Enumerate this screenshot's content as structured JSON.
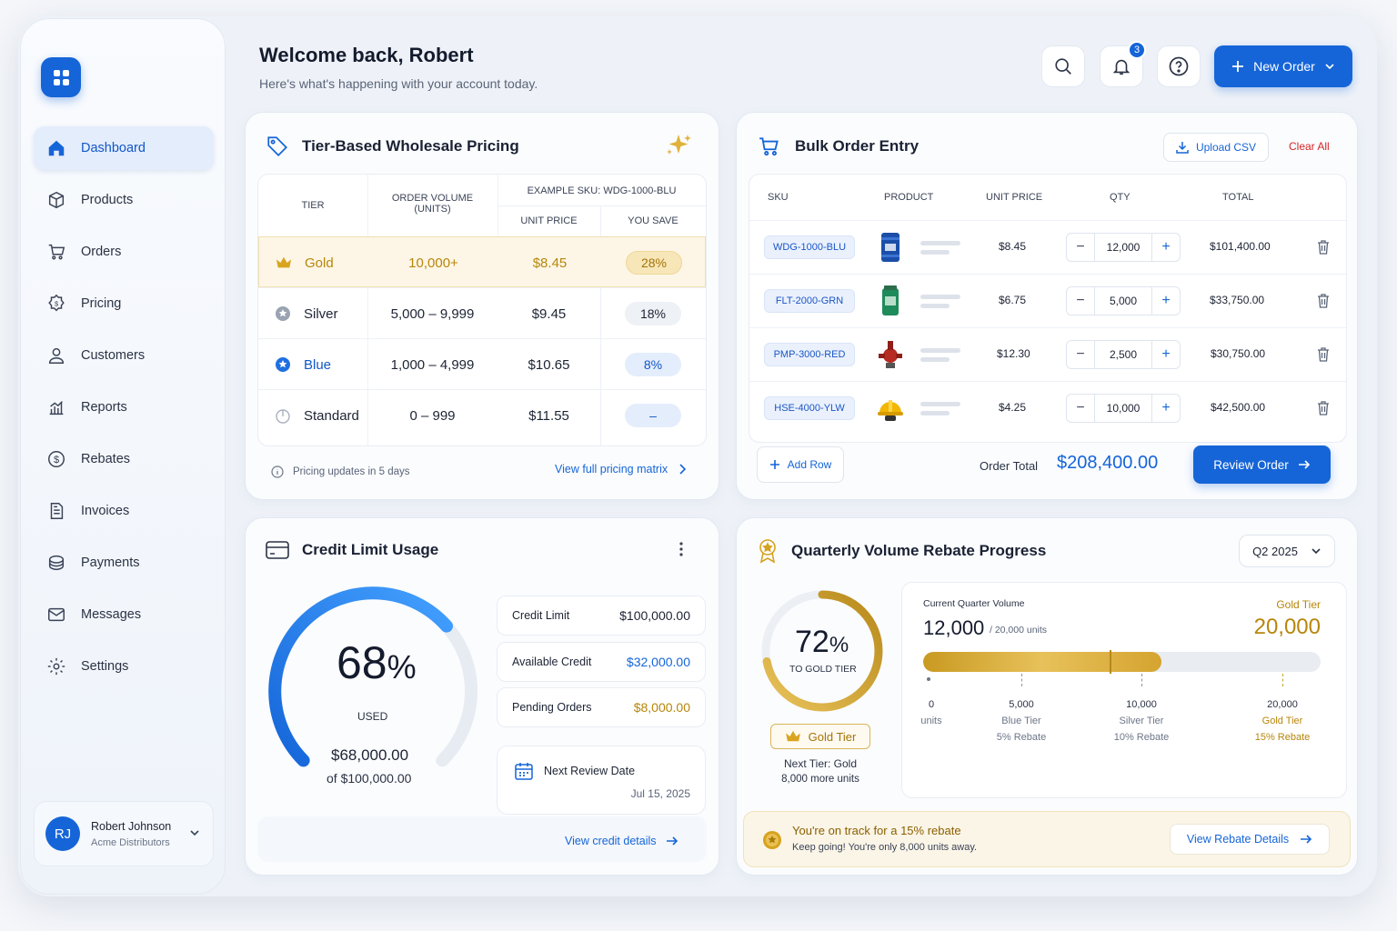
{
  "sidebar": {
    "items": [
      {
        "label": "Dashboard",
        "icon": "home-icon"
      },
      {
        "label": "Products",
        "icon": "box-icon"
      },
      {
        "label": "Orders",
        "icon": "cart-icon"
      },
      {
        "label": "Pricing",
        "icon": "price-badge-icon"
      },
      {
        "label": "Customers",
        "icon": "user-icon"
      },
      {
        "label": "Reports",
        "icon": "bar-chart-icon"
      },
      {
        "label": "Rebates",
        "icon": "dollar-coin-icon"
      },
      {
        "label": "Invoices",
        "icon": "document-icon"
      },
      {
        "label": "Payments",
        "icon": "payment-icon"
      },
      {
        "label": "Messages",
        "icon": "mail-icon"
      },
      {
        "label": "Settings",
        "icon": "gear-icon"
      }
    ],
    "user": {
      "initials": "RJ",
      "name": "Robert Johnson",
      "company": "Acme Distributors"
    }
  },
  "header": {
    "title": "Welcome back, Robert",
    "subtitle": "Here's what's happening with your account today.",
    "notifications": "3",
    "new_order": "New Order"
  },
  "pricing": {
    "title": "Tier-Based Wholesale Pricing",
    "headers": {
      "tier": "TIER",
      "volume": "ORDER VOLUME",
      "volume2": "(UNITS)",
      "example": "EXAMPLE SKU: WDG-1000-BLU",
      "unit_price": "UNIT PRICE",
      "you_save": "YOU SAVE"
    },
    "rows": [
      {
        "tier": "Gold",
        "volume": "10,000+",
        "price": "$8.45",
        "save": "28%"
      },
      {
        "tier": "Silver",
        "volume": "5,000 – 9,999",
        "price": "$9.45",
        "save": "18%"
      },
      {
        "tier": "Blue",
        "volume": "1,000 – 4,999",
        "price": "$10.65",
        "save": "8%"
      },
      {
        "tier": "Standard",
        "volume": "0 – 999",
        "price": "$11.55",
        "save": "–"
      }
    ],
    "footer_note": "Pricing updates in 5 days",
    "footer_link": "View full pricing matrix"
  },
  "bulk": {
    "title": "Bulk Order Entry",
    "upload": "Upload CSV",
    "clear": "Clear All",
    "headers": {
      "sku": "SKU",
      "product": "PRODUCT",
      "unit_price": "UNIT PRICE",
      "qty": "QTY",
      "total": "TOTAL"
    },
    "rows": [
      {
        "sku": "WDG-1000-BLU",
        "price": "$8.45",
        "qty": "12,000",
        "total": "$101,400.00"
      },
      {
        "sku": "FLT-2000-GRN",
        "price": "$6.75",
        "qty": "5,000",
        "total": "$33,750.00"
      },
      {
        "sku": "PMP-3000-RED",
        "price": "$12.30",
        "qty": "2,500",
        "total": "$30,750.00"
      },
      {
        "sku": "HSE-4000-YLW",
        "price": "$4.25",
        "qty": "10,000",
        "total": "$42,500.00"
      }
    ],
    "add_row": "Add Row",
    "order_total_label": "Order Total",
    "order_total": "$208,400.00",
    "review": "Review Order"
  },
  "credit": {
    "title": "Credit Limit Usage",
    "percent": "68",
    "percent_sign": "%",
    "used_label": "USED",
    "used_amount": "$68,000.00",
    "of_amount": "of $100,000.00",
    "percent_value": 0.68,
    "items": [
      {
        "label": "Credit Limit",
        "value": "$100,000.00",
        "color": "#1c2333"
      },
      {
        "label": "Available Credit",
        "value": "$32,000.00",
        "color": "#1565d8"
      },
      {
        "label": "Pending Orders",
        "value": "$8,000.00",
        "color": "#b7860b"
      }
    ],
    "review_label": "Next Review Date",
    "review_date": "Jul 15, 2025",
    "details_link": "View credit details"
  },
  "rebate": {
    "title": "Quarterly Volume Rebate Progress",
    "quarter": "Q2 2025",
    "ring_percent": "72",
    "percent_sign": "%",
    "ring_value": 0.72,
    "ring_label": "TO GOLD TIER",
    "tier_badge": "Gold Tier",
    "next_tier": "Next Tier: Gold",
    "more_units": "8,000 more units",
    "current_label": "Current Quarter Volume",
    "current_value": "12,000",
    "current_units": "/ 20,000 units",
    "target_label": "Gold Tier",
    "target_value": "20,000",
    "bar_progress": 0.6,
    "ticks": [
      {
        "value": "0",
        "line2": "units",
        "line3": ""
      },
      {
        "value": "5,000",
        "line2": "Blue Tier",
        "line3": "5% Rebate"
      },
      {
        "value": "10,000",
        "line2": "Silver Tier",
        "line3": "10% Rebate"
      },
      {
        "value": "20,000",
        "line2": "Gold Tier",
        "line3": "15% Rebate"
      }
    ],
    "banner_title": "You're on track for a 15% rebate",
    "banner_sub": "Keep going! You're only 8,000 units away.",
    "banner_link": "View Rebate Details"
  },
  "colors": {
    "accent": "#1565d8",
    "gold": "#c9a227",
    "gold_text": "#b7860b"
  }
}
